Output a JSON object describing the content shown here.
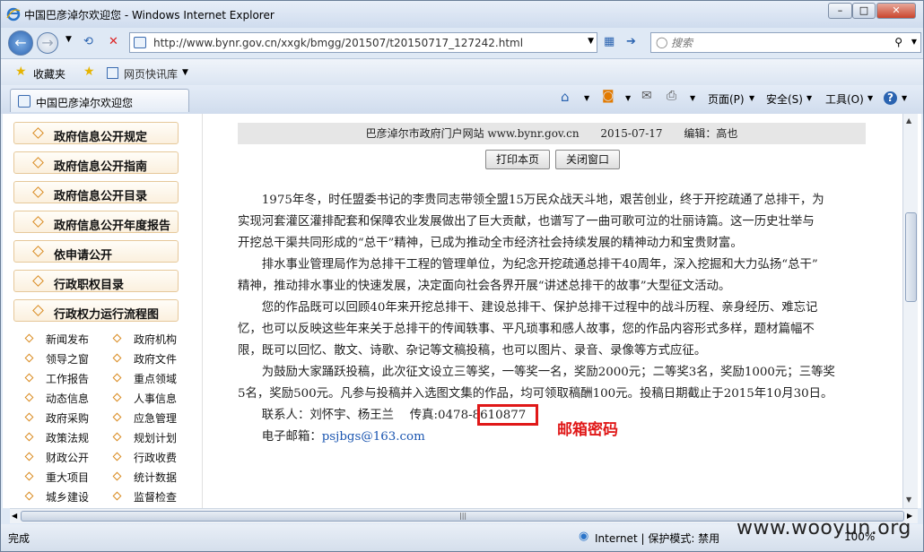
{
  "window": {
    "title": "中国巴彦淖尔欢迎您 - Windows Internet Explorer",
    "min": "–",
    "max": "□",
    "close": "✕"
  },
  "address": {
    "url": "http://www.bynr.gov.cn/xxgk/bmgg/201507/t20150717_127242.html",
    "search_placeholder": "搜索"
  },
  "favorites": {
    "label": "收藏夹",
    "quick": "网页快讯库"
  },
  "tab": {
    "label": "中国巴彦淖尔欢迎您"
  },
  "commands": {
    "page": "页面(P)",
    "safety": "安全(S)",
    "tools": "工具(O)"
  },
  "sidebar": {
    "buttons": [
      "政府信息公开规定",
      "政府信息公开指南",
      "政府信息公开目录",
      "政府信息公开年度报告",
      "依申请公开",
      "行政职权目录",
      "行政权力运行流程图"
    ],
    "links": [
      "新闻发布",
      "政府机构",
      "领导之窗",
      "政府文件",
      "工作报告",
      "重点领域",
      "动态信息",
      "人事信息",
      "政府采购",
      "应急管理",
      "政策法规",
      "规划计划",
      "财政公开",
      "行政收费",
      "重大项目",
      "统计数据",
      "城乡建设",
      "监督检查"
    ]
  },
  "article": {
    "source": "巴彦淖尔市政府门户网站 www.bynr.gov.cn",
    "date": "2015-07-17",
    "editor": "编辑：高也",
    "print_btn": "打印本页",
    "close_btn": "关闭窗口",
    "lines": [
      "　　1975年冬，时任盟委书记的李贵同志带领全盟15万民众战天斗地，艰苦创业，终于开挖疏通了总排干，为",
      "实现河套灌区灌排配套和保障农业发展做出了巨大贡献，也谱写了一曲可歌可泣的壮丽诗篇。这一历史壮举与",
      "开挖总干渠共同形成的“总干”精神，已成为推动全市经济社会持续发展的精神动力和宝贵财富。",
      "　　排水事业管理局作为总排干工程的管理单位，为纪念开挖疏通总排干40周年，深入挖掘和大力弘扬“总干”",
      "精神，推动排水事业的快速发展，决定面向社会各界开展“讲述总排干的故事”大型征文活动。",
      "　　您的作品既可以回顾40年来开挖总排干、建设总排干、保护总排干过程中的战斗历程、亲身经历、难忘记",
      "忆，也可以反映这些年来关于总排干的传闻轶事、平凡琐事和感人故事，您的作品内容形式多样，题材篇幅不",
      "限，既可以回忆、散文、诗歌、杂记等文稿投稿，也可以图片、录音、录像等方式应征。",
      "　　为鼓励大家踊跃投稿，此次征文设立三等奖，一等奖一名，奖励2000元；二等奖3名，奖励1000元；三等奖",
      "5名，奖励500元。凡参与投稿并入选图文集的作品，均可领取稿酬100元。投稿日期截止于2015年10月30日。",
      "　　联系人：刘怀宇、杨王兰　  传真:0478-8610877"
    ],
    "email_label": "　　电子邮箱：",
    "email": "psjbgs@163.com",
    "annotation": "邮箱密码"
  },
  "status": {
    "left": "完成",
    "zone": "Internet | 保护模式: 禁用",
    "zoom": "100%"
  },
  "watermark": "www.wooyun.org"
}
